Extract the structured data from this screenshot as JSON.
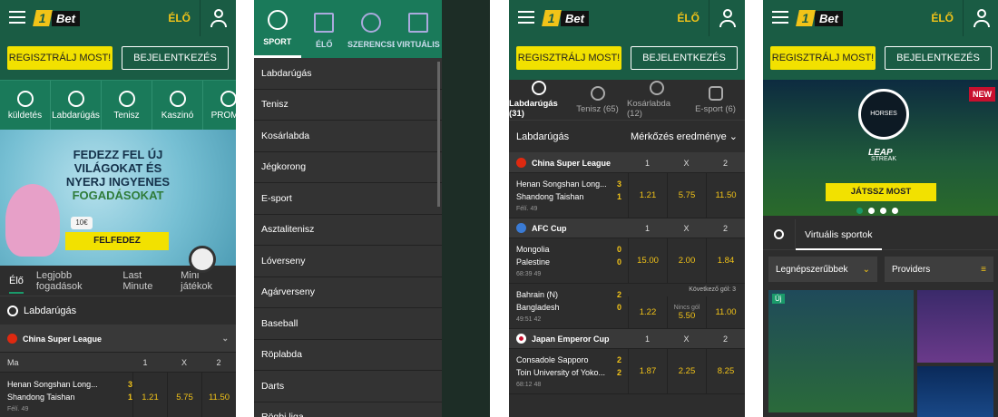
{
  "header": {
    "logo_one": "1",
    "logo_bet": "Bet",
    "elo": "ÉLŐ",
    "register": "REGISZTRÁLJ MOST!",
    "login": "BEJELENTKEZÉS"
  },
  "screen1": {
    "cats": [
      "küldetés",
      "Labdarúgás",
      "Tenisz",
      "Kaszinó",
      "PROMÓ"
    ],
    "banner": {
      "line1": "FEDEZZ FEL ÚJ",
      "line2": "VILÁGOKAT ÉS",
      "line3": "NYERJ INGYENES",
      "line4": "FOGADÁSOKAT",
      "coin": "10€",
      "button": "FELFEDEZ"
    },
    "tabs": [
      "Élő",
      "Legjobb fogadások",
      "Last Minute",
      "Mini játékok"
    ],
    "section": "Labdarúgás",
    "league": "China Super League",
    "cols": {
      "label": "Ma",
      "c1": "1",
      "cx": "X",
      "c2": "2"
    },
    "match": {
      "home": "Henan Songshan Long...",
      "away": "Shandong Taishan",
      "s1": "3",
      "s2": "1",
      "meta": "Félí. 49",
      "o1": "1.21",
      "ox": "5.75",
      "o2": "11.50"
    }
  },
  "screen2": {
    "nav": [
      "SPORT",
      "ÉLŐ",
      "SZERENCSE",
      "VIRTUÁLIS"
    ],
    "menu": [
      "Labdarúgás",
      "Tenisz",
      "Kosárlabda",
      "Jégkorong",
      "E-sport",
      "Asztalitenisz",
      "Lóverseny",
      "Agárverseny",
      "Baseball",
      "Röplabda",
      "Darts",
      "Rögbi liga"
    ]
  },
  "screen3": {
    "sports": [
      "Labdarúgás (31)",
      "Tenisz (65)",
      "Kosárlabda (12)",
      "E-sport (6)"
    ],
    "header": "Labdarúgás",
    "dropdown": "Mérkőzés eredménye",
    "leagues": [
      {
        "name": "China Super League",
        "matches": [
          {
            "home": "Henan Songshan Long...",
            "away": "Shandong Taishan",
            "s1": "3",
            "s2": "1",
            "meta": "Félí. 49",
            "o1": "1.21",
            "ox": "5.75",
            "o2": "11.50",
            "note": "",
            "nox": ""
          }
        ]
      },
      {
        "name": "AFC Cup",
        "matches": [
          {
            "home": "Mongolia",
            "away": "Palestine",
            "s1": "0",
            "s2": "0",
            "meta": "68:39 49",
            "o1": "15.00",
            "ox": "2.00",
            "o2": "1.84",
            "note": "",
            "nox": ""
          },
          {
            "home": "Bahrain (N)",
            "away": "Bangladesh",
            "s1": "2",
            "s2": "0",
            "meta": "49:51 42",
            "o1": "1.22",
            "ox": "5.50",
            "o2": "11.00",
            "note": "Következő gól: 3",
            "nox": "Nincs gól"
          }
        ]
      },
      {
        "name": "Japan Emperor Cup",
        "matches": [
          {
            "home": "Consadole Sapporo",
            "away": "Toin University of Yoko...",
            "s1": "2",
            "s2": "2",
            "meta": "68:12 48",
            "o1": "1.87",
            "ox": "2.25",
            "o2": "8.25",
            "note": "",
            "nox": ""
          }
        ]
      }
    ]
  },
  "screen4": {
    "new": "NEW",
    "seal": "HORSES STREAK",
    "leap": "LEAP",
    "play": "JÁTSSZ MOST",
    "tab": "Virtuális sportok",
    "filter1": "Legnépszerűbbek",
    "filter2": "Providers",
    "badge": "Új"
  },
  "colors": {
    "green": "#1a5c44",
    "accent": "#f2c318",
    "yellow_btn": "#f2e100"
  }
}
